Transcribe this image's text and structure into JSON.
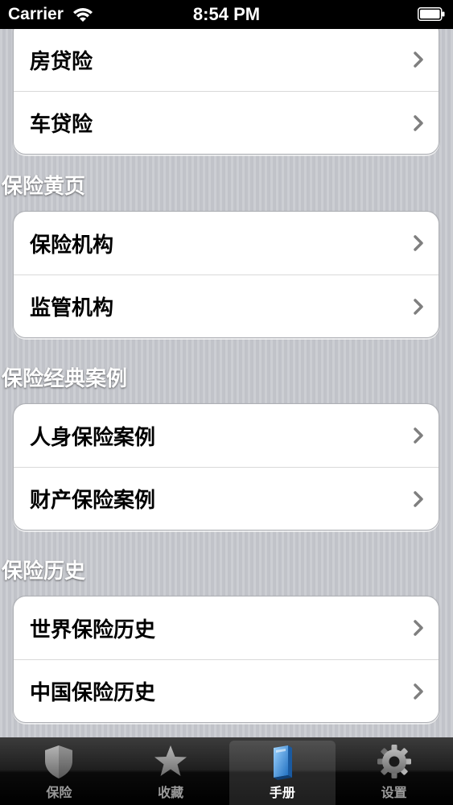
{
  "status_bar": {
    "carrier": "Carrier",
    "time": "8:54 PM"
  },
  "sections": [
    {
      "header": "",
      "items": [
        {
          "label": "房贷险"
        },
        {
          "label": "车贷险"
        }
      ]
    },
    {
      "header": "保险黄页",
      "items": [
        {
          "label": "保险机构"
        },
        {
          "label": "监管机构"
        }
      ]
    },
    {
      "header": "保险经典案例",
      "items": [
        {
          "label": "人身保险案例"
        },
        {
          "label": "财产保险案例"
        }
      ]
    },
    {
      "header": "保险历史",
      "items": [
        {
          "label": "世界保险历史"
        },
        {
          "label": "中国保险历史"
        }
      ]
    }
  ],
  "tab_bar": {
    "tabs": [
      {
        "label": "保险",
        "icon": "shield-icon",
        "active": false
      },
      {
        "label": "收藏",
        "icon": "star-icon",
        "active": false
      },
      {
        "label": "手册",
        "icon": "book-icon",
        "active": true
      },
      {
        "label": "设置",
        "icon": "gear-icon",
        "active": false
      }
    ]
  },
  "colors": {
    "active_tab_label": "#ffffff",
    "inactive_tab_label": "#9b9b9b",
    "active_tab_icon": "#3a8fd8",
    "chevron": "#7f7f7f"
  }
}
